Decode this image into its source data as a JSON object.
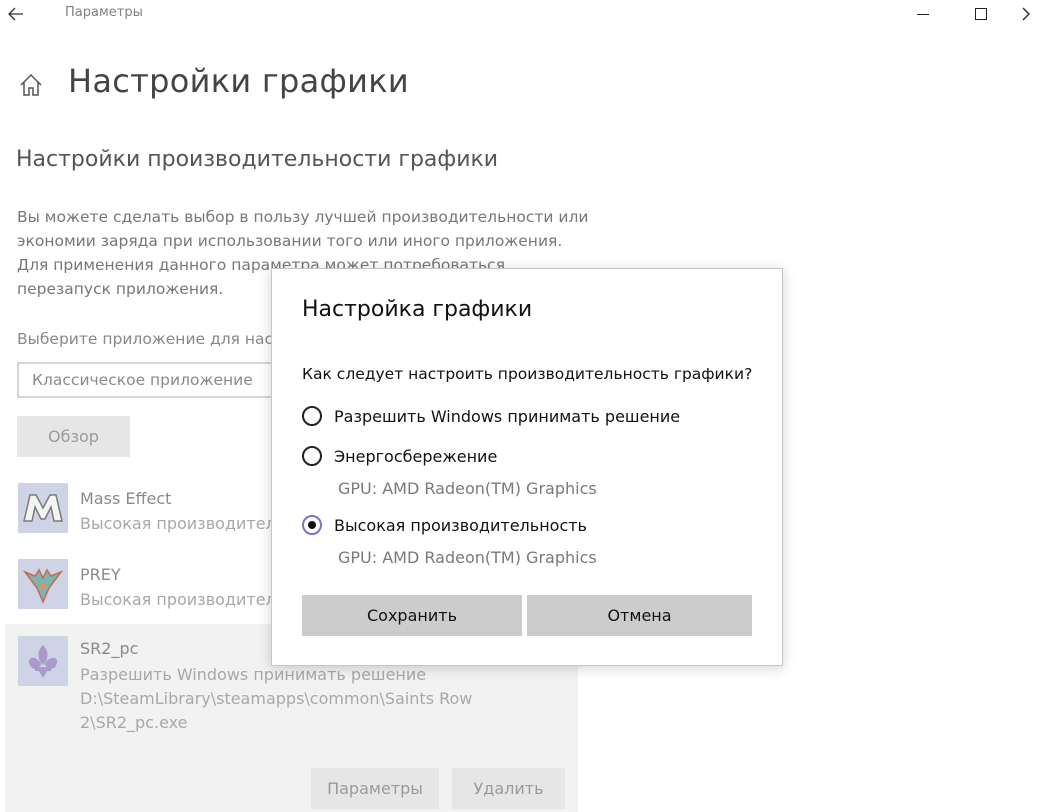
{
  "window": {
    "title": "Параметры",
    "back_icon": "arrow-left-icon",
    "minimize_icon": "minimize-icon",
    "maximize_icon": "maximize-icon",
    "next_icon": "chevron-right-icon"
  },
  "page": {
    "home_icon": "home-icon",
    "title": "Настройки графики",
    "section_title": "Настройки производительности графики",
    "description_lines": [
      "Вы можете сделать выбор в пользу лучшей производительности или",
      "экономии заряда при использовании того или иного приложения.",
      "Для применения данного параметра может потребоваться",
      "перезапуск приложения."
    ],
    "choose_label": "Выберите приложение для настр",
    "app_type_value": "Классическое приложение",
    "browse_label": "Обзор"
  },
  "apps": [
    {
      "name": "Mass Effect",
      "status": "Высокая производительность",
      "icon": "mass-effect-icon"
    },
    {
      "name": "PREY",
      "status": "Высокая производительность",
      "icon": "prey-icon"
    },
    {
      "name": "SR2_pc",
      "status": "Разрешить Windows принимать решение",
      "path_lines": [
        "D:\\SteamLibrary\\steamapps\\common\\Saints Row",
        "2\\SR2_pc.exe"
      ],
      "icon": "fleur-de-lis-icon",
      "options_label": "Параметры",
      "remove_label": "Удалить"
    }
  ],
  "dialog": {
    "title": "Настройка графики",
    "question": "Как следует настроить производительность графики?",
    "options": [
      {
        "label": "Разрешить Windows принимать решение",
        "checked": false
      },
      {
        "label": "Энергосбережение",
        "gpu": "GPU: AMD Radeon(TM) Graphics",
        "checked": false
      },
      {
        "label": "Высокая производительность",
        "gpu": "GPU: AMD Radeon(TM) Graphics",
        "checked": true
      }
    ],
    "save_label": "Сохранить",
    "cancel_label": "Отмена"
  },
  "colors": {
    "radio_checked_ring": "#7e72c8",
    "button_bg": "#cccccc",
    "disabled_button_bg": "#e6e6e6",
    "selected_item_bg": "#f2f2f2"
  }
}
